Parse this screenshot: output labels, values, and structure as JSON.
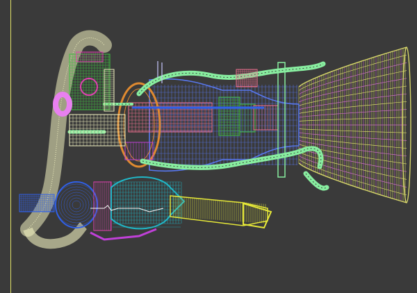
{
  "viewport": {
    "background": "#3a3a3a",
    "active_border_color": "#e2e268",
    "render_mode": "wireframe"
  },
  "palette": {
    "nozzle_yellow": "#d8d86a",
    "nozzle_pink": "#d070c8",
    "pipe_mint": "#88eea0",
    "pipe_cream": "#f2f2c0",
    "chamber_blue": "#5878f0",
    "chamber_pink": "#f07090",
    "turbo_cyan": "#20b8c8",
    "turbo_magenta": "#e040b0",
    "pump_blue": "#3060e8",
    "orange": "#e08a30",
    "green": "#40c040",
    "exhaust_yellow": "#e6e838",
    "violet": "#c040d8"
  }
}
